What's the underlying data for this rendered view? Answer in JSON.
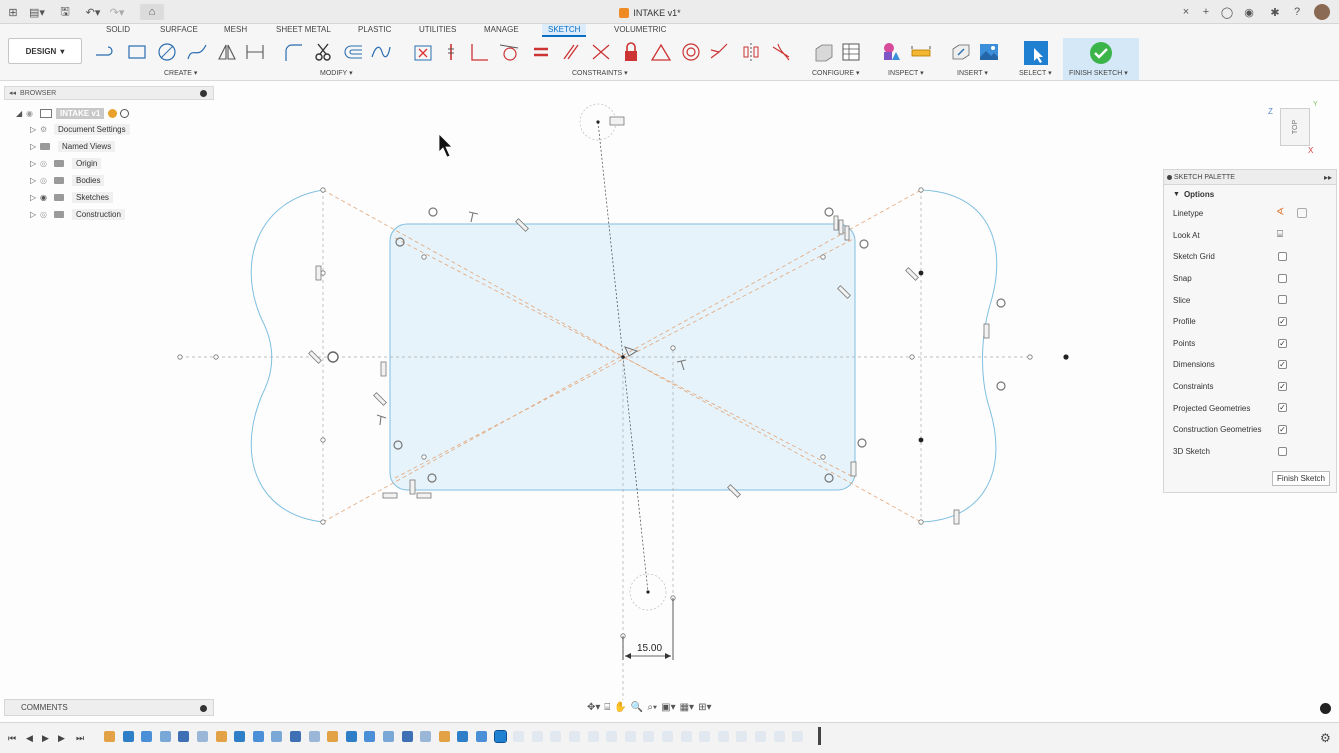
{
  "titlebar": {
    "doc_title": "INTAKE v1*",
    "close": "×",
    "new_tab": "+"
  },
  "toolbar": {
    "tabs": [
      "SOLID",
      "SURFACE",
      "MESH",
      "SHEET METAL",
      "PLASTIC",
      "UTILITIES",
      "MANAGE",
      "SKETCH",
      "VOLUMETRIC"
    ],
    "active_tab": "SKETCH",
    "workspace": "DESIGN",
    "groups": {
      "create": "CREATE",
      "modify": "MODIFY",
      "constraints": "CONSTRAINTS",
      "configure": "CONFIGURE",
      "inspect": "INSPECT",
      "insert": "INSERT",
      "select": "SELECT",
      "finish": "FINISH SKETCH"
    },
    "dropdown_marker": "▾"
  },
  "browser": {
    "title": "BROWSER",
    "root": "INTAKE v1",
    "items": [
      {
        "label": "Document Settings"
      },
      {
        "label": "Named Views"
      },
      {
        "label": "Origin"
      },
      {
        "label": "Bodies"
      },
      {
        "label": "Sketches"
      },
      {
        "label": "Construction"
      }
    ]
  },
  "sketch_palette": {
    "title": "SKETCH PALETTE",
    "section": "Options",
    "options": [
      {
        "label": "Linetype",
        "kind": "linetype"
      },
      {
        "label": "Look At",
        "kind": "icon"
      },
      {
        "label": "Sketch Grid",
        "kind": "checkbox",
        "checked": false
      },
      {
        "label": "Snap",
        "kind": "checkbox",
        "checked": false
      },
      {
        "label": "Slice",
        "kind": "checkbox",
        "checked": false
      },
      {
        "label": "Profile",
        "kind": "checkbox",
        "checked": true
      },
      {
        "label": "Points",
        "kind": "checkbox",
        "checked": true
      },
      {
        "label": "Dimensions",
        "kind": "checkbox",
        "checked": true
      },
      {
        "label": "Constraints",
        "kind": "checkbox",
        "checked": true
      },
      {
        "label": "Projected Geometries",
        "kind": "checkbox",
        "checked": true
      },
      {
        "label": "Construction Geometries",
        "kind": "checkbox",
        "checked": true
      },
      {
        "label": "3D Sketch",
        "kind": "checkbox",
        "checked": false
      }
    ],
    "finish_button": "Finish Sketch"
  },
  "canvas": {
    "dimension": "15.00"
  },
  "viewcube": {
    "face": "TOP",
    "axis_z": "Z",
    "axis_x": "X",
    "axis_y": "Y"
  },
  "comments": {
    "title": "COMMENTS"
  },
  "colors": {
    "accent": "#0a6fc2",
    "profile_fill": "#e6f3fa",
    "sketch_line": "#7fbfe0",
    "construction_line": "#e3a67a",
    "finish_green": "#3bb54a"
  }
}
